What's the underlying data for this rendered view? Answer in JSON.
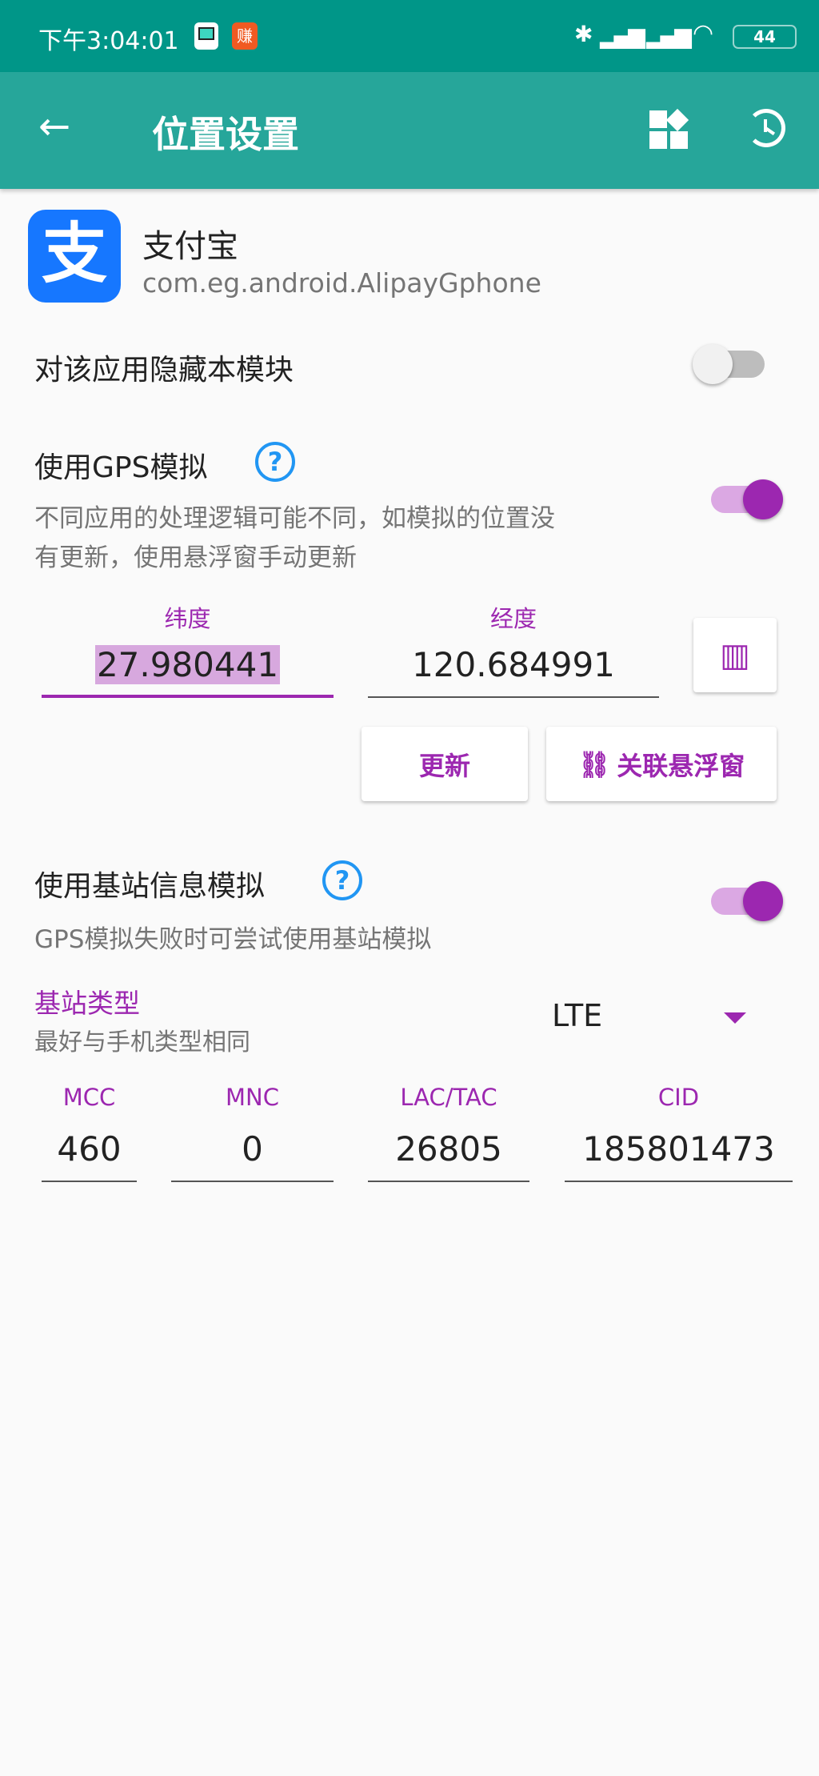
{
  "status_bar": {
    "time": "下午3:04:01",
    "battery": "44",
    "notification_badge": "赚"
  },
  "app_bar": {
    "title": "位置设置",
    "back_icon": "arrow-left-icon",
    "actions": [
      "widgets-icon",
      "history-icon"
    ]
  },
  "app": {
    "name": "支付宝",
    "package": "com.eg.android.AlipayGphone",
    "icon_color": "#1677ff"
  },
  "hide_module": {
    "label": "对该应用隐藏本模块",
    "enabled": false
  },
  "gps": {
    "label": "使用GPS模拟",
    "description_line1": "不同应用的处理逻辑可能不同，如模拟的位置没",
    "description_line2": "有更新，使用悬浮窗手动更新",
    "enabled": true,
    "latitude_label": "纬度",
    "latitude": "27.980441",
    "longitude_label": "经度",
    "longitude": "120.684991",
    "update_button": "更新",
    "link_button": "关联悬浮窗"
  },
  "cell": {
    "label": "使用基站信息模拟",
    "description": "GPS模拟失败时可尝试使用基站模拟",
    "enabled": true,
    "type_label": "基站类型",
    "type_hint": "最好与手机类型相同",
    "type_value": "LTE",
    "fields": [
      {
        "label": "MCC",
        "value": "460"
      },
      {
        "label": "MNC",
        "value": "0"
      },
      {
        "label": "LAC/TAC",
        "value": "26805"
      },
      {
        "label": "CID",
        "value": "185801473"
      }
    ]
  },
  "colors": {
    "accent": "#9c27b0",
    "status_bar": "#009688",
    "app_bar": "#26a69a"
  }
}
